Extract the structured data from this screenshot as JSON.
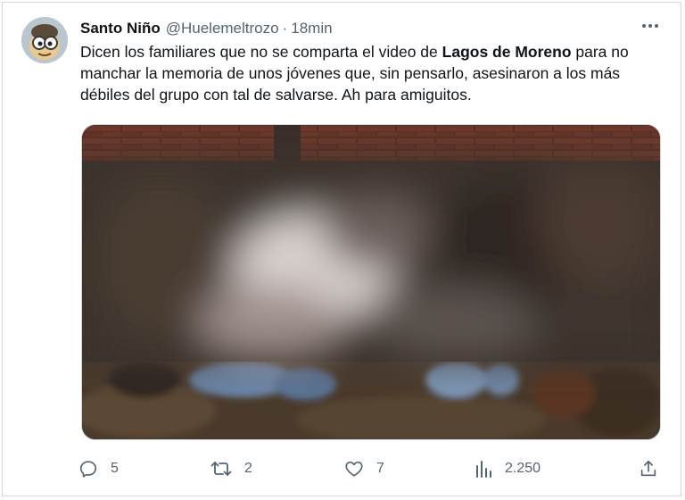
{
  "tweet": {
    "author_name": "Santo Niño",
    "author_handle": "@Huelemeltrozo",
    "separator": "·",
    "time": "18min",
    "text_part1": "Dicen los familiares que no se comparta el video de ",
    "text_bold": "Lagos de Moreno",
    "text_part2": " para no manchar la memoria de unos jóvenes que, sin pensarlo, asesinaron a los más débiles del grupo con tal de salvarse. Ah para amiguitos."
  },
  "actions": {
    "replies": "5",
    "retweets": "2",
    "likes": "7",
    "views": "2.250"
  },
  "icons": {
    "more": "more-horizontal-icon",
    "reply": "reply-icon",
    "retweet": "retweet-icon",
    "like": "heart-icon",
    "views": "analytics-icon",
    "share": "share-icon"
  },
  "colors": {
    "text": "#0f1419",
    "secondary": "#536471",
    "border": "#cfd9de"
  }
}
